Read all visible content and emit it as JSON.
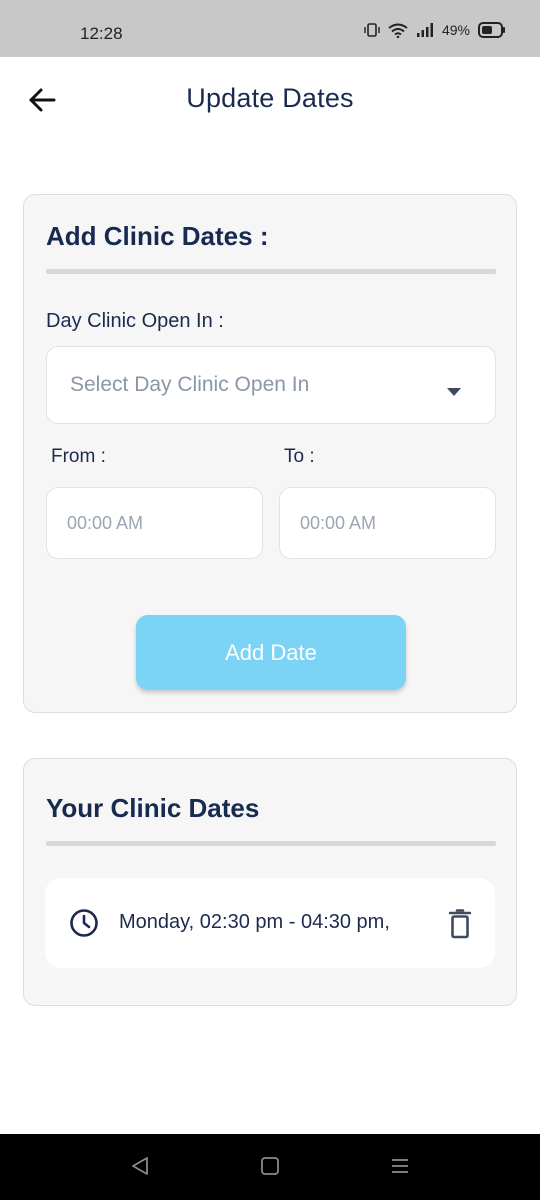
{
  "status_bar": {
    "time": "12:28",
    "battery": "49%"
  },
  "header": {
    "title": "Update Dates"
  },
  "add_card": {
    "title": "Add Clinic Dates :",
    "day_label": "Day Clinic Open In :",
    "day_placeholder": "Select Day Clinic Open In",
    "from_label": "From :",
    "to_label": "To :",
    "from_placeholder": "00:00 AM",
    "to_placeholder": "00:00 AM",
    "add_button_label": "Add Date"
  },
  "dates_card": {
    "title": "Your Clinic Dates",
    "items": [
      {
        "text": "Monday, 02:30 pm - 04:30 pm,"
      }
    ]
  },
  "colors": {
    "primary_text": "#1b2a4e",
    "button": "#7bd3f5",
    "card_bg": "#f6f6f7"
  }
}
